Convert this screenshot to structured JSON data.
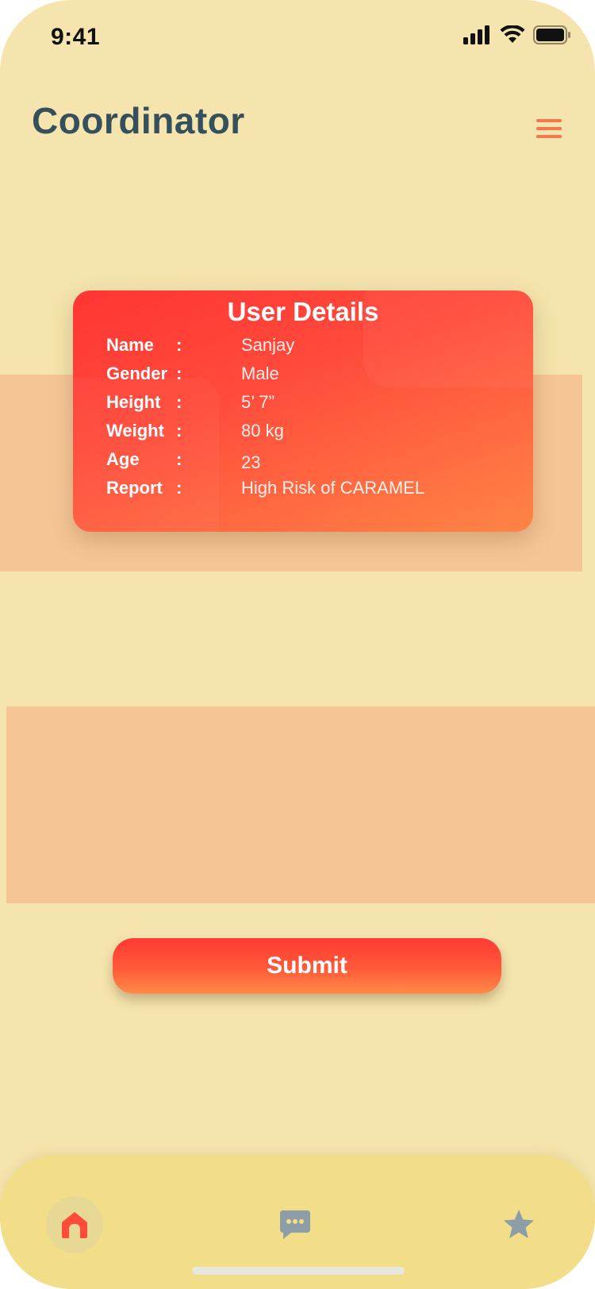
{
  "status_bar": {
    "time": "9:41",
    "icons": [
      "signal-icon",
      "wifi-icon",
      "battery-icon"
    ]
  },
  "header": {
    "title": "Coordinator",
    "menu_icon": "hamburger-menu-icon"
  },
  "user_card": {
    "title": "User Details",
    "separator": ":",
    "rows": [
      {
        "label": "Name",
        "value": "Sanjay"
      },
      {
        "label": "Gender",
        "value": "Male"
      },
      {
        "label": "Height",
        "value": "5’ 7”"
      },
      {
        "label": "Weight",
        "value": "80 kg"
      },
      {
        "label": "Age",
        "value": "23"
      },
      {
        "label": "Report",
        "value": "High Risk of CARAMEL"
      }
    ]
  },
  "actions": {
    "submit_label": "Submit"
  },
  "bottom_nav": {
    "items": [
      {
        "icon": "home-icon",
        "active": true
      },
      {
        "icon": "chat-icon",
        "active": false
      },
      {
        "icon": "star-icon",
        "active": false
      }
    ]
  },
  "colors": {
    "background": "#f5e4ad",
    "band": "#f5c596",
    "accent": "#ff3a33",
    "accent_end": "#ff8c47",
    "title": "#33505c",
    "nav_inactive": "#8e9ea8"
  }
}
